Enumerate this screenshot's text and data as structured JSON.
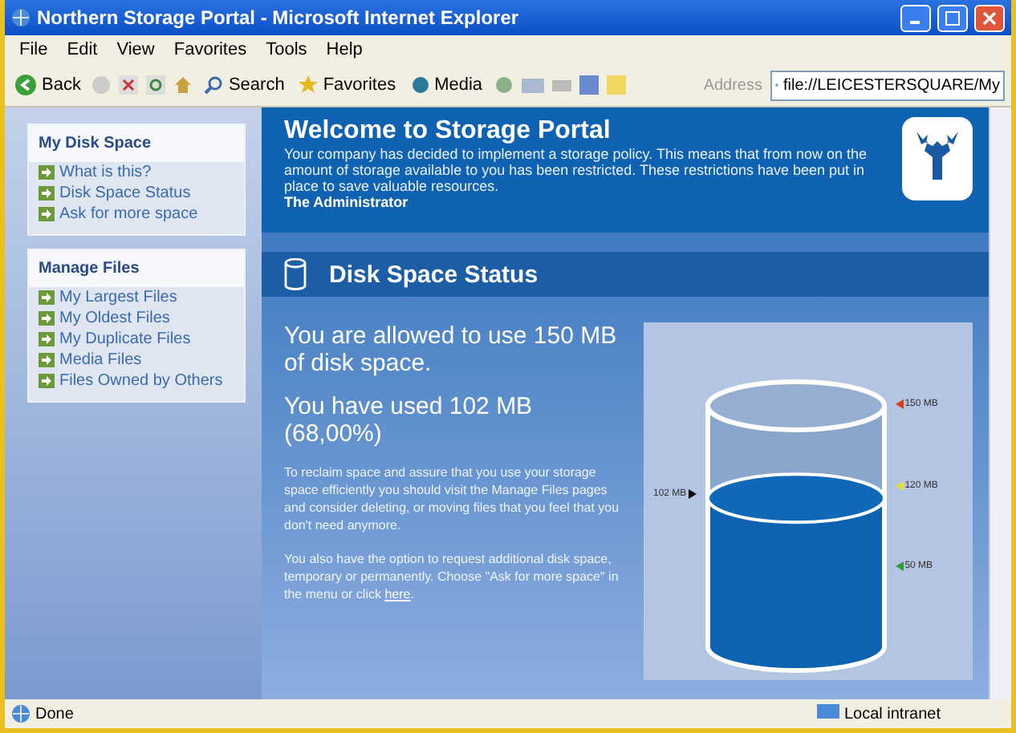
{
  "window": {
    "title": "Northern Storage Portal - Microsoft Internet Explorer"
  },
  "menu": [
    "File",
    "Edit",
    "View",
    "Favorites",
    "Tools",
    "Help"
  ],
  "toolbar": {
    "back": "Back",
    "search": "Search",
    "favorites": "Favorites",
    "media": "Media",
    "address_label": "Address",
    "address": "file://LEICESTERSQUARE/My"
  },
  "sidebar": [
    {
      "title": "My Disk Space",
      "items": [
        "What is this?",
        "Disk Space Status",
        "Ask for more space"
      ]
    },
    {
      "title": "Manage Files",
      "items": [
        "My Largest Files",
        "My Oldest Files",
        "My Duplicate Files",
        "Media Files",
        "Files Owned by Others"
      ]
    }
  ],
  "header": {
    "title": "Welcome to Storage Portal",
    "message": "Your company has decided to implement a storage policy. This means that from now on the amount of storage available to you has been restricted. These restrictions have been put in place to save valuable resources.",
    "signature": "The Administrator"
  },
  "section": {
    "title": "Disk Space Status",
    "allowed": "You are allowed to use 150 MB of disk space.",
    "used": "You have used 102 MB (68,00%)",
    "advice": "To reclaim space and assure that you use your storage space efficiently you should visit the Manage Files pages and consider deleting, or moving files that you feel that you don't need anymore.",
    "request": {
      "text": "You also have the option to request additional disk space, temporary or permanently. Choose \"Ask for more space\" in the menu or click ",
      "link": "here",
      "after": "."
    }
  },
  "gauge": {
    "level": 0.68,
    "reading": "102 MB",
    "markers": [
      {
        "label": "150 MB",
        "color": "#d83a1c"
      },
      {
        "label": "120 MB",
        "color": "#e8e030"
      },
      {
        "label": "50 MB",
        "color": "#2a9a3a"
      }
    ]
  },
  "status_bar": {
    "text": "Done",
    "zone": "Local intranet"
  }
}
